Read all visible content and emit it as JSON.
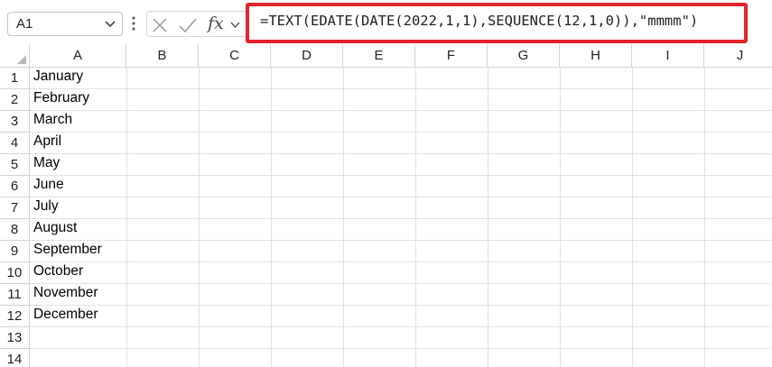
{
  "formula_bar": {
    "name_box": "A1",
    "fx_label": "fx",
    "formula": "=TEXT(EDATE(DATE(2022,1,1),SEQUENCE(12,1,0)),\"mmmm\")"
  },
  "columns": [
    "A",
    "B",
    "C",
    "D",
    "E",
    "F",
    "G",
    "H",
    "I",
    "J"
  ],
  "rows": [
    "1",
    "2",
    "3",
    "4",
    "5",
    "6",
    "7",
    "8",
    "9",
    "10",
    "11",
    "12",
    "13",
    "14"
  ],
  "column_a": [
    "January",
    "February",
    "March",
    "April",
    "May",
    "June",
    "July",
    "August",
    "September",
    "October",
    "November",
    "December",
    "",
    ""
  ],
  "colors": {
    "highlight_border": "#e3242b"
  }
}
